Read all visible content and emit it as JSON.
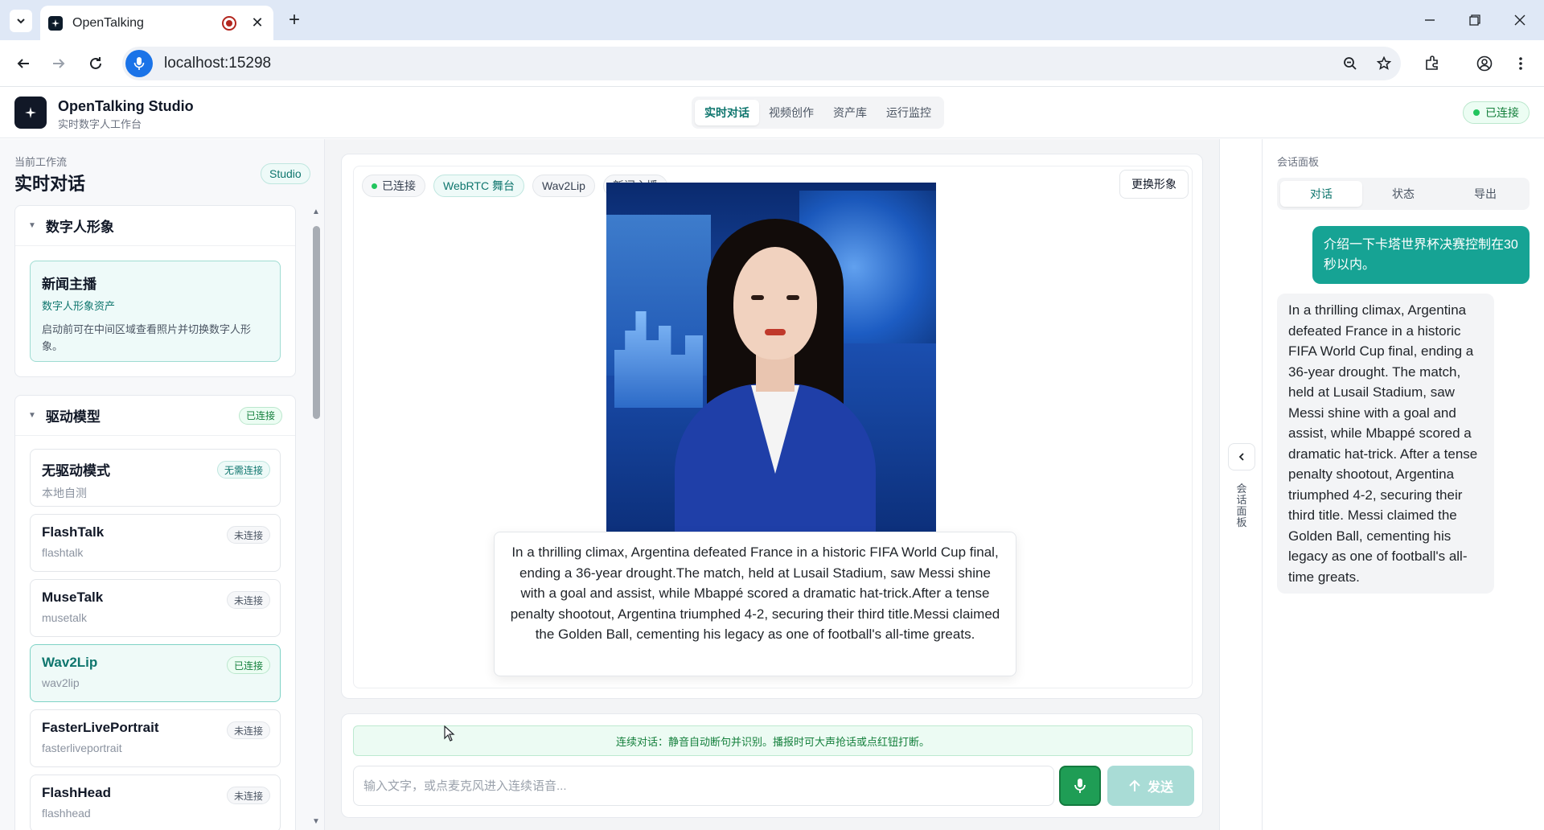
{
  "browser": {
    "tab_title": "OpenTalking",
    "url": "localhost:15298",
    "new_tab": "+",
    "close_tab": "✕"
  },
  "header": {
    "brand_title": "OpenTalking Studio",
    "brand_sub": "实时数字人工作台",
    "nav": [
      "实时对话",
      "视频创作",
      "资产库",
      "运行监控"
    ],
    "connection": "已连接"
  },
  "sidebar": {
    "workflow_label": "当前工作流",
    "workflow_title": "实时对话",
    "studio_badge": "Studio",
    "avatar_card": {
      "title": "数字人形象",
      "item_name": "新闻主播",
      "item_type": "数字人形象资产",
      "item_desc": "启动前可在中间区域查看照片并切换数字人形象。"
    },
    "model_card": {
      "title": "驱动模型",
      "status": "已连接",
      "models": [
        {
          "name": "无驱动模式",
          "sub": "本地自测",
          "status": "无需连接"
        },
        {
          "name": "FlashTalk",
          "sub": "flashtalk",
          "status": "未连接"
        },
        {
          "name": "MuseTalk",
          "sub": "musetalk",
          "status": "未连接"
        },
        {
          "name": "Wav2Lip",
          "sub": "wav2lip",
          "status": "已连接"
        },
        {
          "name": "FasterLivePortrait",
          "sub": "fasterliveportrait",
          "status": "未连接"
        },
        {
          "name": "FlashHead",
          "sub": "flashhead",
          "status": "未连接"
        }
      ]
    }
  },
  "stage": {
    "tags": [
      "已连接",
      "WebRTC 舞台",
      "Wav2Lip",
      "新闻主播"
    ],
    "swap_button": "更换形象",
    "caption": "In a thrilling climax, Argentina defeated France in a historic FIFA World Cup final, ending a 36-year drought.The match, held at Lusail Stadium, saw Messi shine with a goal and assist, while Mbappé scored a dramatic hat-trick.After a tense penalty shootout, Argentina triumphed 4-2, securing their third title.Messi claimed the Golden Ball, cementing his legacy as one of football's all-time greats."
  },
  "composer": {
    "hint": "连续对话：静音自动断句并识别。播报时可大声抢话或点红钮打断。",
    "placeholder": "输入文字，或点麦克风进入连续语音...",
    "send_label": "发送"
  },
  "rail": {
    "label": "会话面板"
  },
  "chat_panel": {
    "title": "会话面板",
    "tabs": [
      "对话",
      "状态",
      "导出"
    ],
    "user_message": "介绍一下卡塔世界杯决赛控制在30秒以内。",
    "bot_message": "In a thrilling climax, Argentina defeated France in a historic FIFA World Cup final, ending a 36-year drought. The match, held at Lusail Stadium, saw Messi shine with a goal and assist, while Mbappé scored a dramatic hat-trick. After a tense penalty shootout, Argentina triumphed 4-2, securing their third title. Messi claimed the Golden Ball, cementing his legacy as one of football's all-time greats."
  }
}
